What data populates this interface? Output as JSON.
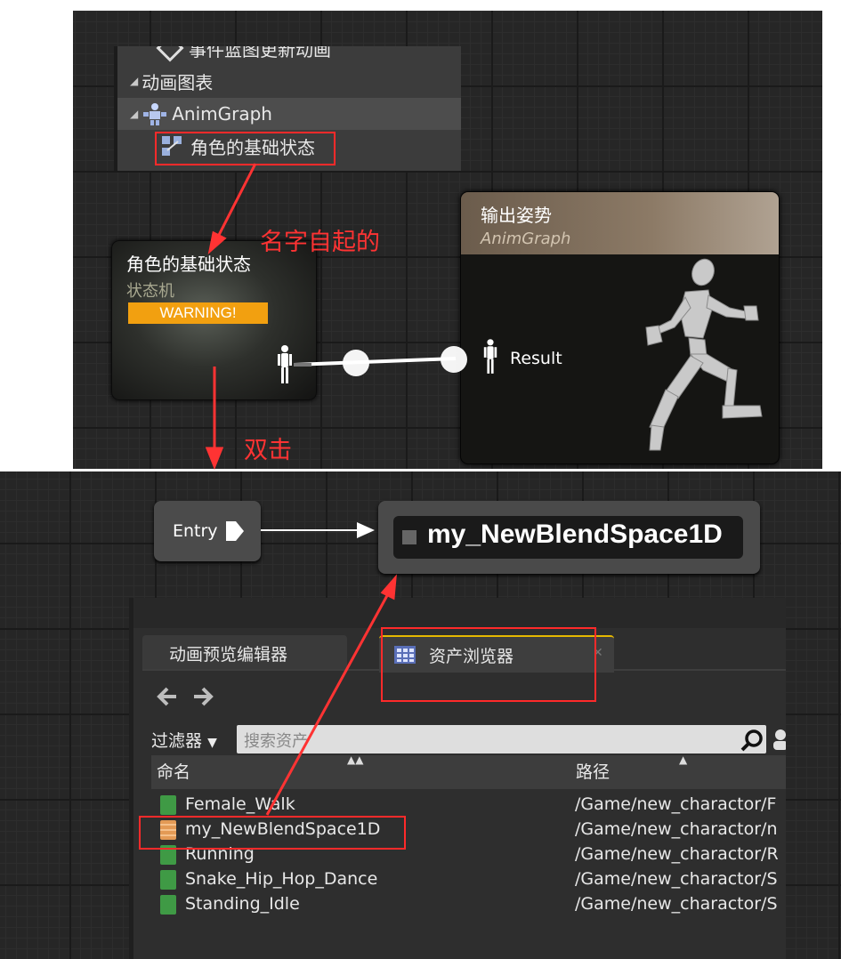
{
  "tree": {
    "items": [
      {
        "label": "事件蓝图更新动画"
      },
      {
        "label": "动画图表"
      },
      {
        "label": "AnimGraph"
      },
      {
        "label": "角色的基础状态"
      }
    ]
  },
  "state_machine_node": {
    "title": "角色的基础状态",
    "subtitle": "状态机",
    "warning": "WARNING!"
  },
  "output_node": {
    "title": "输出姿势",
    "subtitle": "AnimGraph",
    "pin_label": "Result"
  },
  "annotations": {
    "name_note": "名字自起的",
    "double_click_note": "双击"
  },
  "state_graph": {
    "entry_label": "Entry",
    "blendspace_label": "my_NewBlendSpace1D"
  },
  "asset_browser": {
    "tabs": [
      {
        "label": "动画预览编辑器"
      },
      {
        "label": "资产浏览器"
      }
    ],
    "filter_label": "过滤器",
    "search_placeholder": "搜索资产",
    "columns": {
      "name": "命名",
      "path": "路径"
    },
    "rows": [
      {
        "name": "Female_Walk",
        "path": "/Game/new_charactor/F",
        "type": "animation"
      },
      {
        "name": "my_NewBlendSpace1D",
        "path": "/Game/new_charactor/n",
        "type": "blendspace"
      },
      {
        "name": "Running",
        "path": "/Game/new_charactor/R",
        "type": "animation"
      },
      {
        "name": "Snake_Hip_Hop_Dance",
        "path": "/Game/new_charactor/S",
        "type": "animation"
      },
      {
        "name": "Standing_Idle",
        "path": "/Game/new_charactor/S",
        "type": "animation"
      }
    ]
  },
  "colors": {
    "warning": "#f2a010",
    "highlight": "#ff2a2a",
    "annotation": "#ff3333"
  }
}
